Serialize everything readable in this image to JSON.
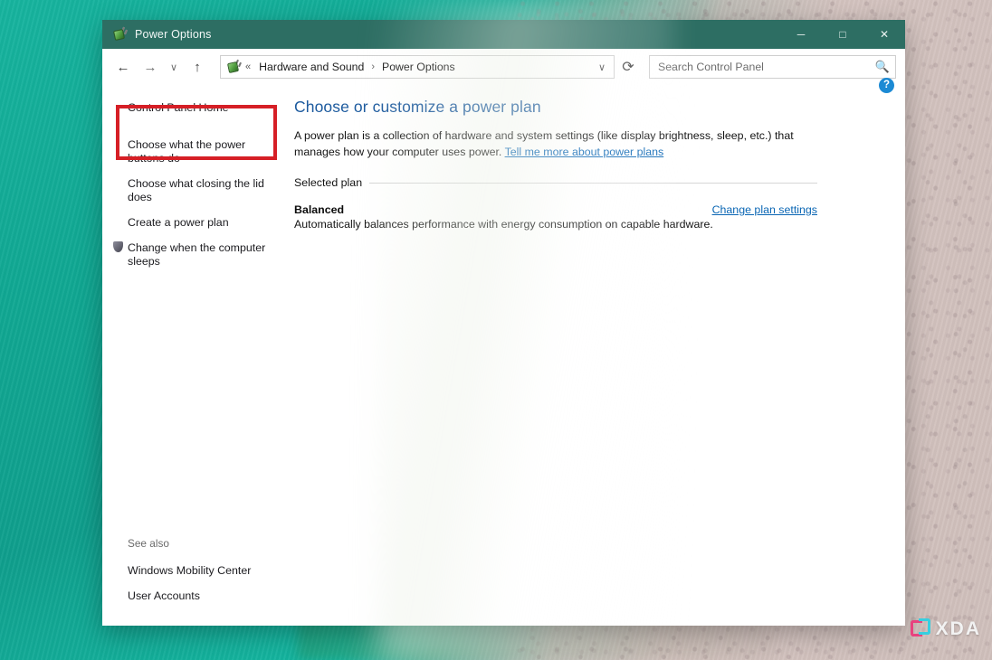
{
  "window": {
    "title": "Power Options",
    "title_icon": "power-plug-icon",
    "controls": {
      "minimize": "─",
      "maximize": "□",
      "close": "✕"
    }
  },
  "nav": {
    "back": "←",
    "forward": "→",
    "recent": "∨",
    "up": "↑",
    "address_icon": "power-plug-icon",
    "overflow_chevrons": "«",
    "breadcrumbs": [
      {
        "label": "Hardware and Sound"
      },
      {
        "label": "Power Options"
      }
    ],
    "separator": "›",
    "dropdown": "∨",
    "refresh": "⟳"
  },
  "search": {
    "placeholder": "Search Control Panel",
    "value": "",
    "icon": "search-icon"
  },
  "sidebar": {
    "home_label": "Control Panel Home",
    "items": [
      {
        "label": "Choose what the power buttons do",
        "shielded": false
      },
      {
        "label": "Choose what closing the lid does",
        "shielded": false
      },
      {
        "label": "Create a power plan",
        "shielded": false
      },
      {
        "label": "Change when the computer sleeps",
        "shielded": true
      }
    ],
    "see_also_label": "See also",
    "see_also": [
      {
        "label": "Windows Mobility Center"
      },
      {
        "label": "User Accounts"
      }
    ]
  },
  "content": {
    "help_label": "?",
    "title": "Choose or customize a power plan",
    "description_before": "A power plan is a collection of hardware and system settings (like display brightness, sleep, etc.) that manages how your computer uses power. ",
    "description_link": "Tell me more about power plans",
    "group_label": "Selected plan",
    "plan_name": "Balanced",
    "plan_settings_link": "Change plan settings",
    "plan_description": "Automatically balances performance with energy consumption on capable hardware."
  },
  "annotation": {
    "highlight_color": "#d61f26",
    "highlight_target": "Choose what the power buttons do"
  },
  "watermark": {
    "text": "XDA"
  },
  "colors": {
    "titlebar": "#2d6e63",
    "heading": "#1c5a9e",
    "link": "#0a66b4",
    "help_badge": "#1c8ad4"
  }
}
